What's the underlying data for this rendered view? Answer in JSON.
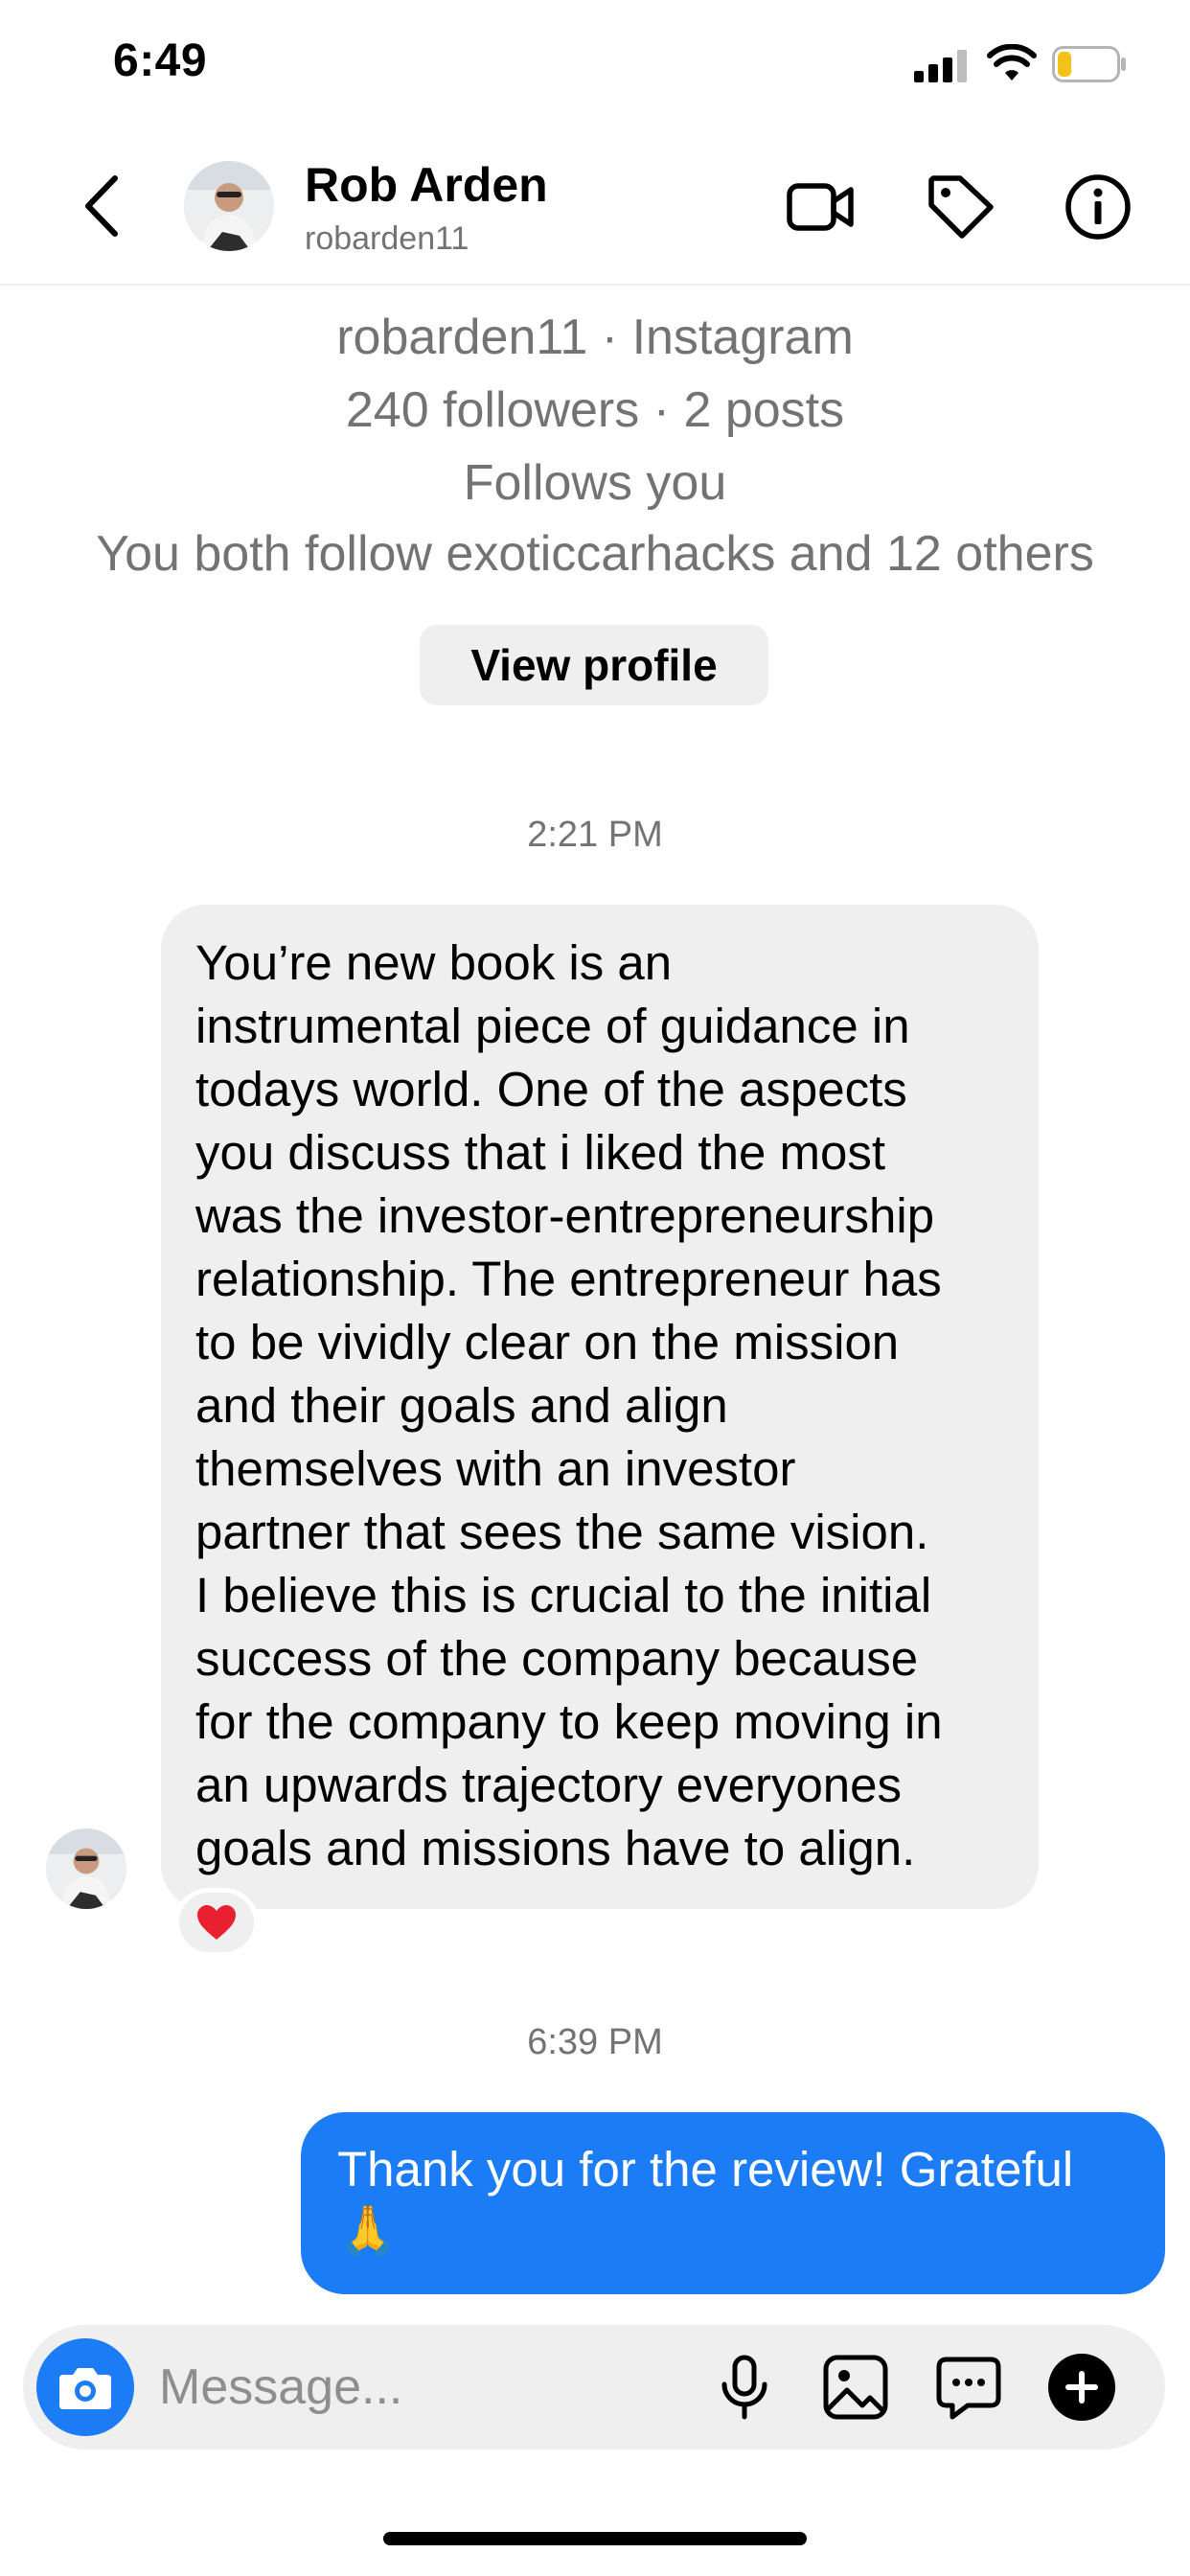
{
  "status_bar": {
    "time": "6:49"
  },
  "header": {
    "name": "Rob Arden",
    "username": "robarden11",
    "icons": [
      "back-chevron-icon",
      "video-camera-icon",
      "tag-icon",
      "info-icon"
    ]
  },
  "profile_card": {
    "line1": "robarden11 · Instagram",
    "line2": "240 followers · 2 posts",
    "line3": "Follows you",
    "line4": "You both follow exoticcarhacks and 12 others",
    "view_profile_label": "View profile"
  },
  "messages": [
    {
      "timestamp": "2:21 PM",
      "direction": "received",
      "lines": [
        "You’re new book is an",
        "instrumental piece of guidance in",
        "todays world. One of the aspects",
        "you discuss that i liked the most",
        "was the investor-entrepreneurship",
        "relationship. The entrepreneur has",
        "to be vividly clear on the mission",
        "and their goals and align",
        "themselves with an investor",
        "partner that sees the same vision.",
        "I believe this is crucial to the initial",
        "success of the company because",
        "for the company to keep moving in",
        "an upwards trajectory everyones",
        "goals and missions have to align."
      ],
      "reaction": "❤️"
    },
    {
      "timestamp": "6:39 PM",
      "direction": "sent",
      "lines": [
        "Thank you for the review! Grateful",
        "🙏"
      ]
    }
  ],
  "composer": {
    "placeholder": "Message...",
    "icons": [
      "camera-icon",
      "microphone-icon",
      "gallery-icon",
      "sticker-chat-icon",
      "plus-icon"
    ]
  },
  "colors": {
    "accent_blue": "#1b7cf5",
    "bubble_gray": "#efefef",
    "secondary_text": "#737373"
  }
}
